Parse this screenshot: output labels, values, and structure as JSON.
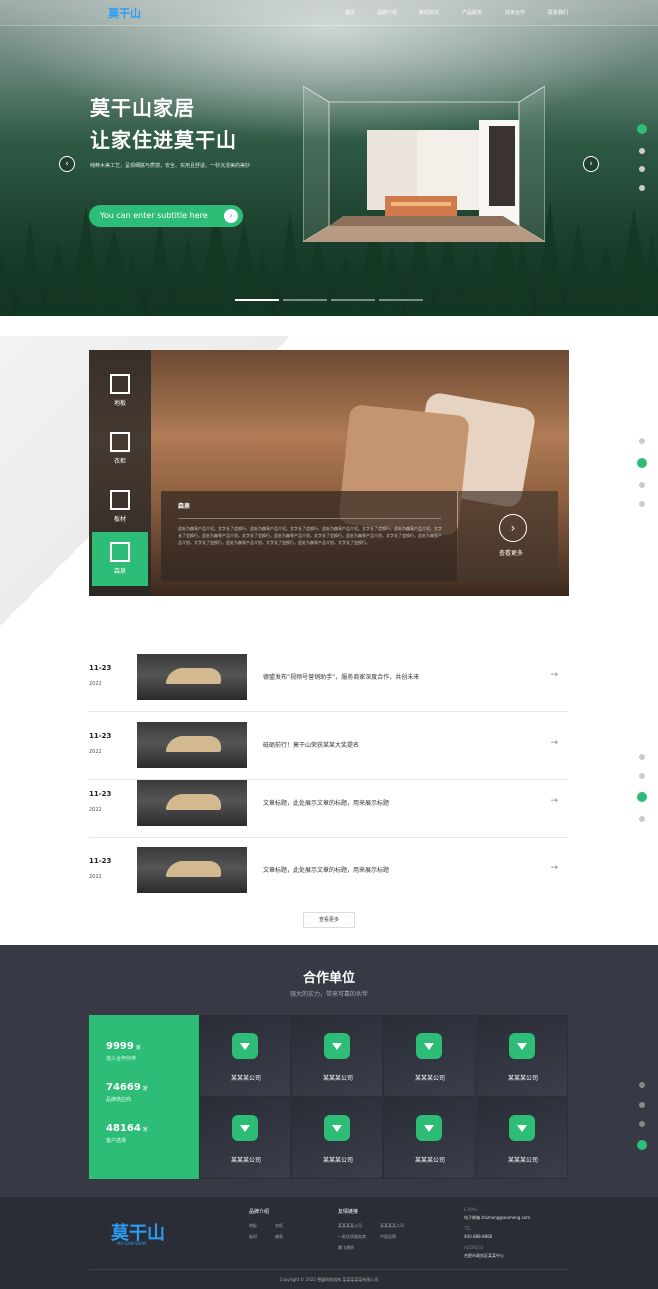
{
  "nav": {
    "logo": "莫干山",
    "items": [
      "首页",
      "品牌介绍",
      "新闻资讯",
      "产品服务",
      "商务合作",
      "联系我们"
    ]
  },
  "hero": {
    "title1": "莫干山家居",
    "title2": "让家住进莫干山",
    "desc": "纯粹木美工艺，呈现细腻与质感，安全、实用且舒适，一秒沉浸美的美妙",
    "button": "You can enter subtitle here",
    "prev": "‹",
    "next": "›",
    "slide_count": 4,
    "active_slide": 1
  },
  "products": {
    "tabs": [
      "地板",
      "衣柜",
      "板材",
      "森泉"
    ],
    "active_tab": "森泉",
    "caption_title": "森泉",
    "caption_text": "此处为森泉产品介绍，文字长了会换行，此处为森泉产品介绍，文字长了会换行，此处为森泉产品介绍，文字长了会换行，此处为森泉产品介绍，文字长了会换行，此处为森泉产品介绍，文字长了会换行，此处为森泉产品介绍，文字长了会换行，此处为森泉产品介绍，文字长了会换行，此处为森泉产品介绍，文字长了会换行，此处为森泉产品介绍，文字长了会换行，此处为森泉产品介绍，文字长了会换行。",
    "more": "查看更多"
  },
  "news": {
    "items": [
      {
        "date": "11-23",
        "year": "2022",
        "title": "德盟发布“视频号营销助手”，服务商家深度合作，共创未来"
      },
      {
        "date": "11-23",
        "year": "2022",
        "title": "砥砺前行！莫干山荣获某某大奖提名"
      },
      {
        "date": "11-23",
        "year": "2022",
        "title": "文章标题，此处展示文章的标题，用来展示标题"
      },
      {
        "date": "11-23",
        "year": "2022",
        "title": "文章标题，此处展示文章的标题，用来展示标题"
      }
    ],
    "more": "查看更多"
  },
  "partners": {
    "title": "合作单位",
    "subtitle": "强大的实力，带来可靠的伙伴",
    "stats": [
      {
        "num": "9999",
        "unit": "家",
        "label": "加入合作伙伴"
      },
      {
        "num": "74669",
        "unit": "家",
        "label": "品牌供应商"
      },
      {
        "num": "48164",
        "unit": "家",
        "label": "客户选择"
      }
    ],
    "companies": [
      "某某某公司",
      "某某某公司",
      "某某某公司",
      "某某某公司",
      "某某某公司",
      "某某某公司",
      "某某某公司",
      "某某某公司"
    ]
  },
  "footer": {
    "logo": "莫干山",
    "logo_sub": "MO GAN SHAN",
    "col1_title": "品牌介绍",
    "col1_links": [
      "地板",
      "衣柜",
      "板材",
      "森泉"
    ],
    "col2_title": "友情链接",
    "col2_links": [
      "某某某某公司",
      "某某某某公司",
      "一款优质服务商",
      "中国品牌",
      "腾飞建筑"
    ],
    "email_label": "E-MAIL",
    "email": "电子邮箱 zhizhong@womeng.com",
    "tel_label": "TEL",
    "tel": "400-888-8866",
    "address_label": "ADDRESS",
    "address": "合肥市政务区某某中心",
    "copyright": "Copyright © 2022 德盟网络机构 某某某某某有限公司"
  },
  "colors": {
    "accent": "#2ebd76",
    "dark": "#373a45",
    "logo": "#2a9df4"
  }
}
